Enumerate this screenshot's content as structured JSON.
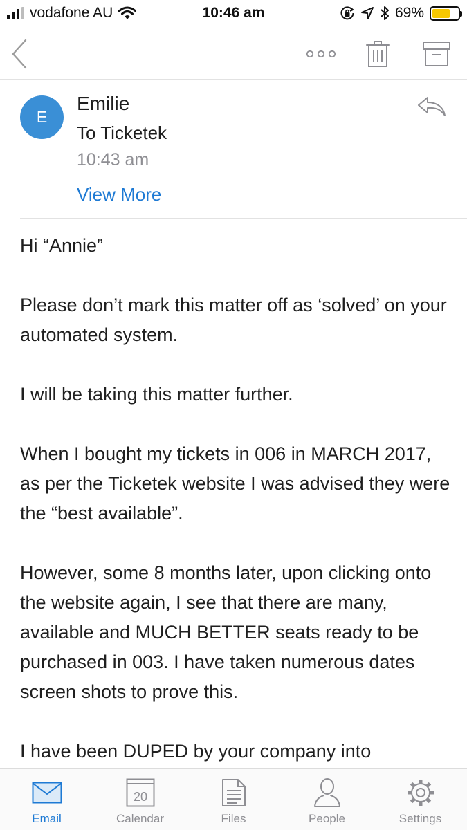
{
  "status_bar": {
    "carrier": "vodafone AU",
    "time": "10:46 am",
    "battery_percent": "69%",
    "battery_level": 0.69,
    "battery_color": "#f7c800",
    "signal_bars_active": 3,
    "signal_bars_total": 4
  },
  "nav_bar": {
    "back_icon": "chevron-left-icon",
    "more_icon": "more-dots-icon",
    "delete_icon": "trash-icon",
    "archive_icon": "archive-icon"
  },
  "message": {
    "avatar_initial": "E",
    "avatar_color": "#3a8fd6",
    "sender": "Emilie",
    "recipient_line": "To Ticketek",
    "time": "10:43 am",
    "view_more_label": "View More",
    "reply_icon": "reply-icon",
    "body": [
      "Hi “Annie”",
      "Please don’t mark this matter off as ‘solved’ on your automated system.",
      "I will be taking this matter further.",
      "When I bought my tickets in 006 in MARCH 2017, as per the Ticketek website I was advised they were the “best available”.",
      "However, some 8 months later, upon clicking onto the website again, I see that there are many, available and MUCH BETTER seats ready to be purchased in 003. I have taken numerous dates screen shots to prove this.",
      "I have been DUPED by your company into"
    ]
  },
  "tab_bar": {
    "active_color": "#1e7ad4",
    "tabs": [
      {
        "label": "Email",
        "icon": "mail-icon",
        "active": true
      },
      {
        "label": "Calendar",
        "icon": "calendar-icon",
        "active": false,
        "calendar_day": "20"
      },
      {
        "label": "Files",
        "icon": "file-icon",
        "active": false
      },
      {
        "label": "People",
        "icon": "person-icon",
        "active": false
      },
      {
        "label": "Settings",
        "icon": "gear-icon",
        "active": false
      }
    ]
  }
}
